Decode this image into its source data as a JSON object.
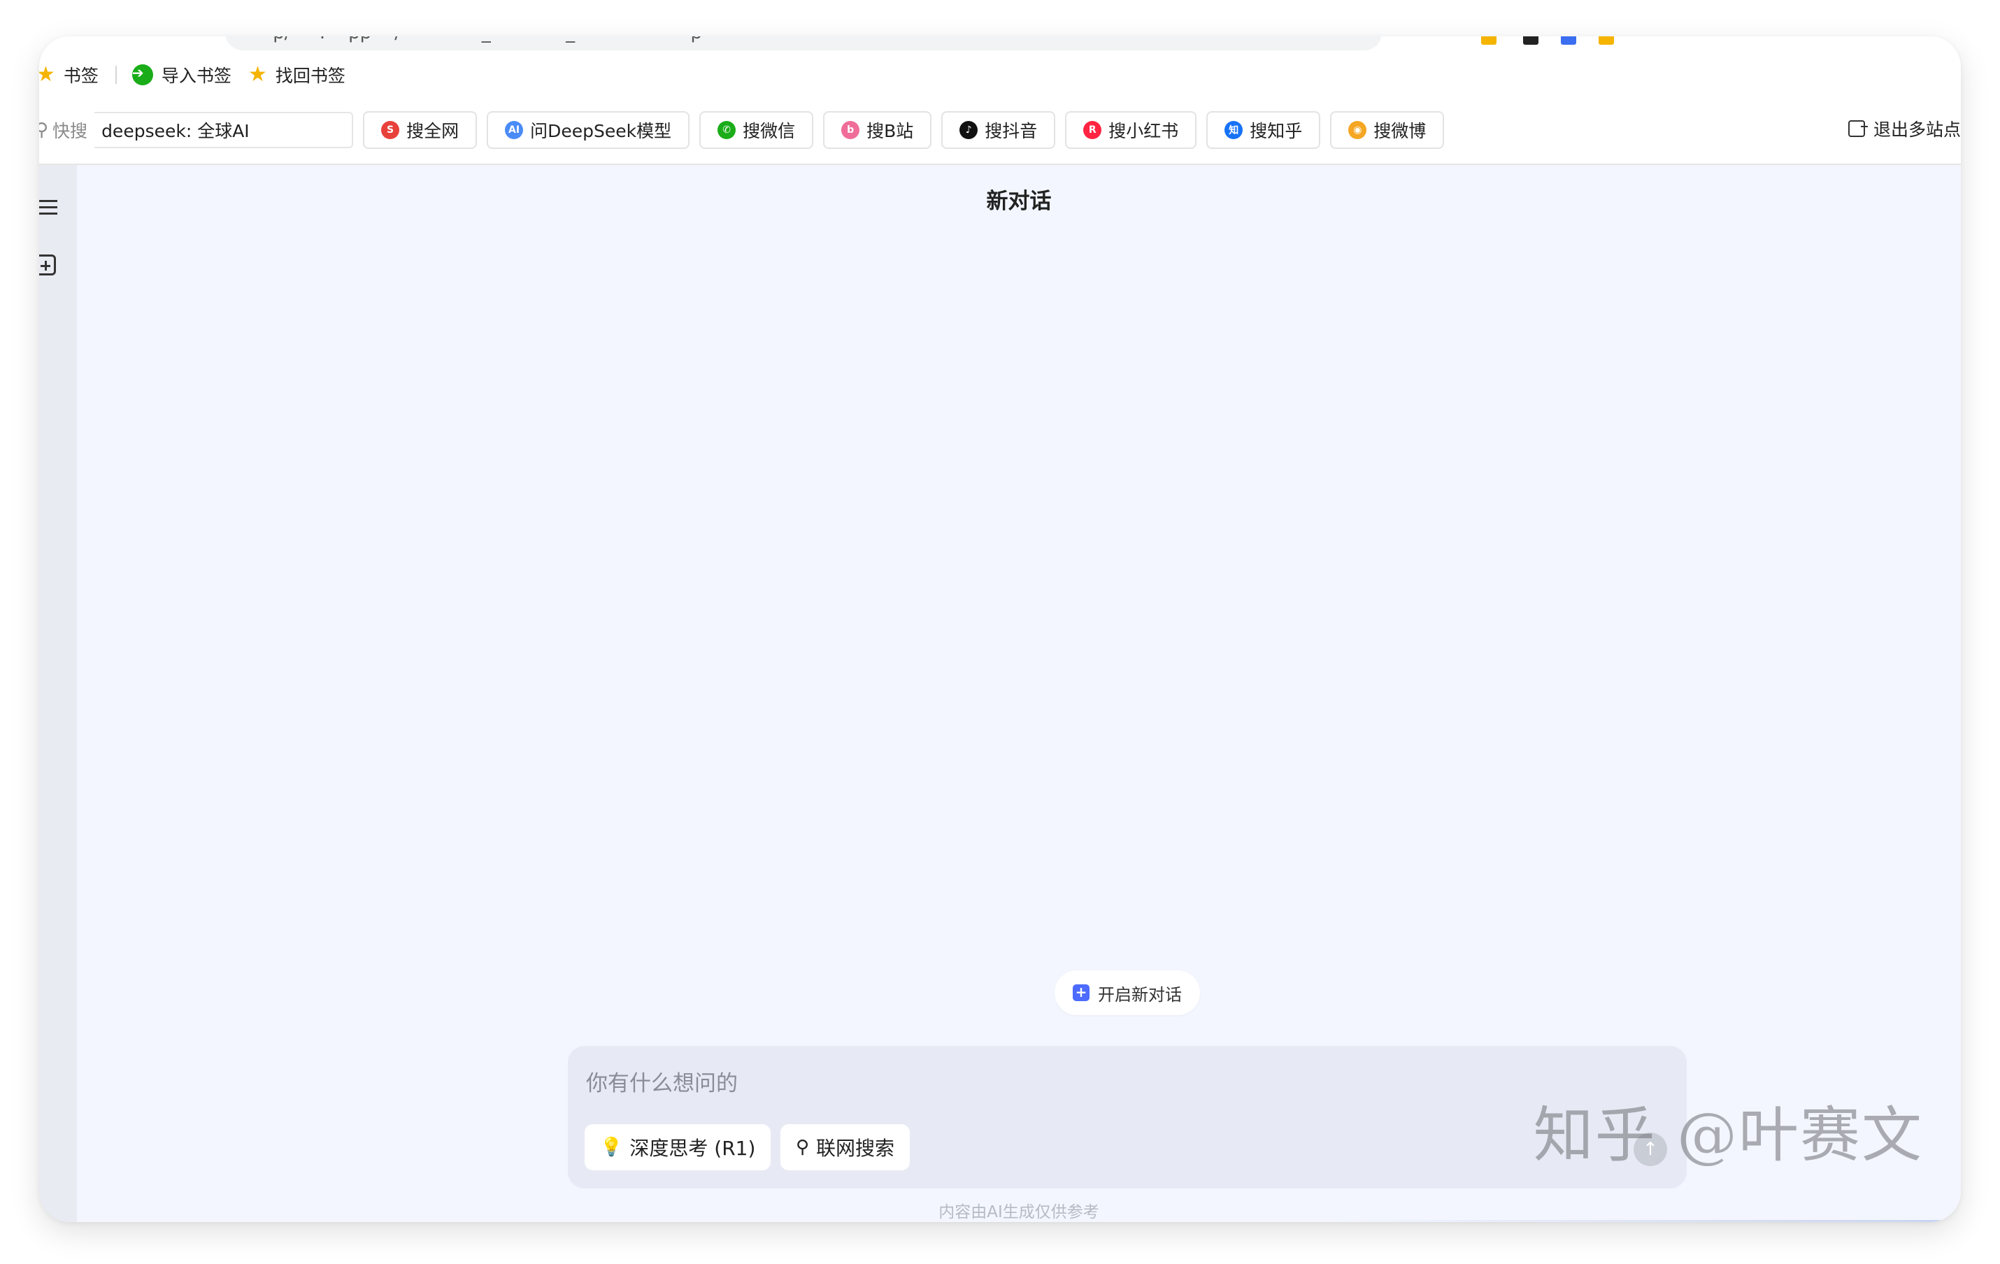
{
  "browser": {
    "url_fragment": "·p/ ··· .·· ·pp ·· /· ·· ·· · ·· ·_· · · · · · ·_ · · ·· ·· · · · ···p"
  },
  "bookmarks_bar": {
    "items": [
      {
        "label": "书签",
        "icon": "star-icon"
      },
      {
        "label": "导入书签",
        "icon": "import-icon"
      },
      {
        "label": "找回书签",
        "icon": "star-icon"
      }
    ]
  },
  "quick_search": {
    "label": "快搜",
    "query": "deepseek: 全球AI",
    "engines": [
      {
        "label": "搜全网",
        "icon": "sogou-icon",
        "color": "#e8403b",
        "glyph": "S"
      },
      {
        "label": "问DeepSeek模型",
        "icon": "ai-icon",
        "color": "#4a8cf7",
        "glyph": "AI"
      },
      {
        "label": "搜微信",
        "icon": "wechat-icon",
        "color": "#1aad19",
        "glyph": "✆"
      },
      {
        "label": "搜B站",
        "icon": "bilibili-icon",
        "color": "#f06d99",
        "glyph": "b"
      },
      {
        "label": "搜抖音",
        "icon": "douyin-icon",
        "color": "#111111",
        "glyph": "♪"
      },
      {
        "label": "搜小红书",
        "icon": "xiaohongshu-icon",
        "color": "#ff2442",
        "glyph": "R"
      },
      {
        "label": "搜知乎",
        "icon": "zhihu-icon",
        "color": "#1772f6",
        "glyph": "知"
      },
      {
        "label": "搜微博",
        "icon": "weibo-icon",
        "color": "#f5a623",
        "glyph": "◉"
      }
    ],
    "exit_label": "退出多站点"
  },
  "chat": {
    "title": "新对话",
    "new_chat_label": "开启新对话",
    "input_placeholder": "你有什么想问的",
    "deep_think_label": "深度思考 (R1)",
    "web_search_label": "联网搜索",
    "disclaimer": "内容由AI生成仅供参考"
  },
  "watermark": "知乎 @叶赛文",
  "colors": {
    "accent": "#4d6bfe",
    "main_bg": "#f3f6fe",
    "composer_bg": "#e7eaf4"
  }
}
